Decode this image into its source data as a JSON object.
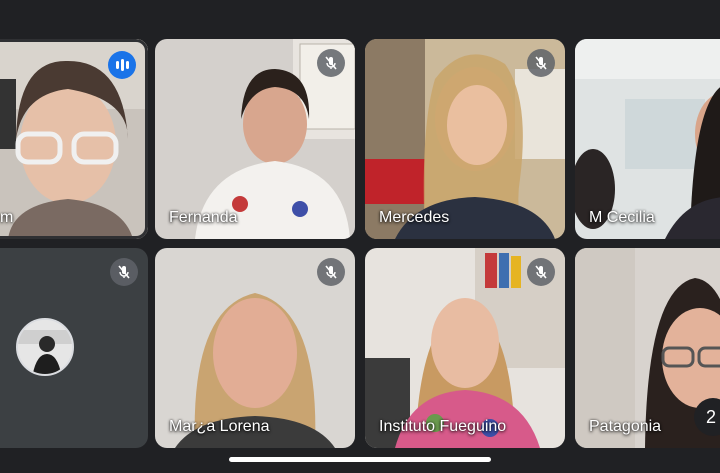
{
  "participants": [
    {
      "name": "m",
      "mic": "speaking"
    },
    {
      "name": "Fernanda",
      "mic": "muted"
    },
    {
      "name": "Mercedes",
      "mic": "muted"
    },
    {
      "name": "M Cecilia",
      "mic": "none"
    },
    {
      "name": "",
      "mic": "muted"
    },
    {
      "name": "Mar¿a Lorena",
      "mic": "muted"
    },
    {
      "name": "Instituto Fueguino",
      "mic": "muted"
    },
    {
      "name": "Patagonia",
      "mic": "none"
    }
  ],
  "overflow_count": "2",
  "colors": {
    "speaking": "#1a73e8",
    "background": "#202124"
  }
}
